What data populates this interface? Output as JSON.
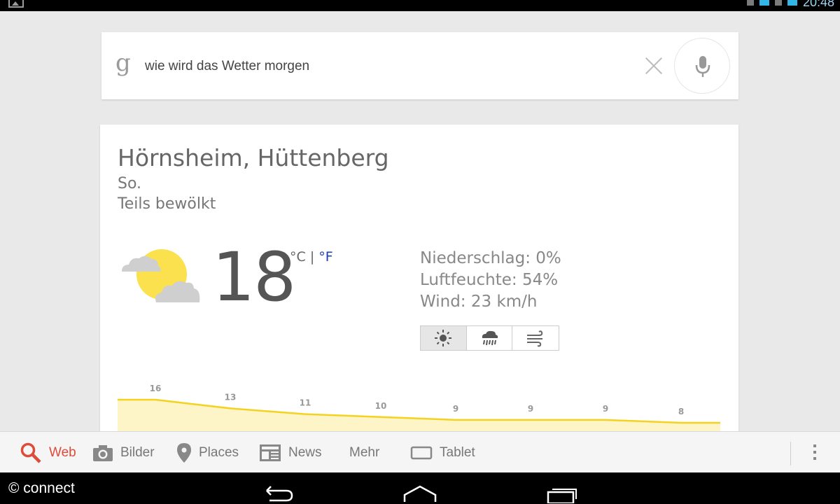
{
  "status_bar": {
    "time": "20:48"
  },
  "search": {
    "logo_letter": "g",
    "query": "wie wird das Wetter morgen",
    "clear_icon": "close-icon",
    "mic_icon": "microphone-icon"
  },
  "weather": {
    "location": "Hörnsheim, Hüttenberg",
    "day": "So.",
    "condition": "Teils bewölkt",
    "temperature": "18",
    "unit_c": "°C",
    "unit_sep": "|",
    "unit_f": "°F",
    "precipitation": "Niederschlag: 0%",
    "humidity": "Luftfeuchte: 54%",
    "wind": "Wind: 23 km/h",
    "view_buttons": [
      {
        "icon": "sun-icon",
        "active": true
      },
      {
        "icon": "rain-cloud-icon",
        "active": false
      },
      {
        "icon": "wind-icon",
        "active": false
      }
    ],
    "colors": {
      "chart_line": "#f4d21f",
      "chart_fill": "#fdf5c7",
      "sun": "#fbe14d",
      "cloud": "#c8c8c8",
      "accent": "#dd4b39",
      "unit_link": "#1a3fb5"
    }
  },
  "chart_data": {
    "type": "area",
    "values": [
      16,
      13,
      11,
      10,
      9,
      9,
      9,
      8
    ],
    "ylim": [
      0,
      20
    ],
    "grid": false
  },
  "tabs": [
    {
      "label": "Web",
      "icon": "search-icon",
      "active": true
    },
    {
      "label": "Bilder",
      "icon": "camera-icon",
      "active": false
    },
    {
      "label": "Places",
      "icon": "map-pin-icon",
      "active": false
    },
    {
      "label": "News",
      "icon": "newspaper-icon",
      "active": false
    },
    {
      "label": "Mehr",
      "icon": "",
      "active": false
    },
    {
      "label": "Tablet",
      "icon": "tablet-icon",
      "active": false
    }
  ],
  "watermark": "© connect"
}
